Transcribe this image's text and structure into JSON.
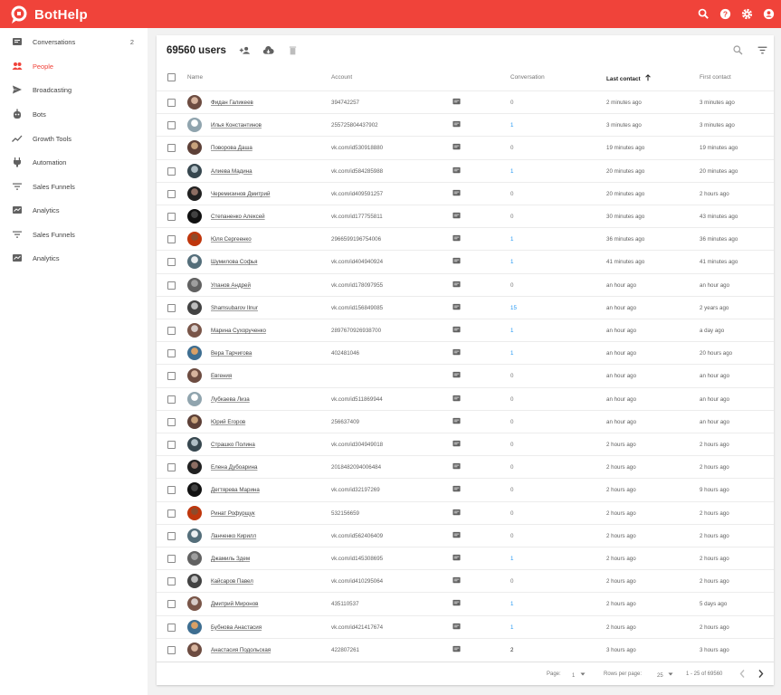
{
  "app": {
    "name": "BotHelp"
  },
  "topbar_icons": [
    "search-icon",
    "help-icon",
    "gear-icon",
    "account-icon"
  ],
  "sidebar": {
    "items": [
      {
        "label": "Conversations",
        "count": "2",
        "icon": "chat-icon",
        "active": false
      },
      {
        "label": "People",
        "count": "",
        "icon": "people-icon",
        "active": true
      },
      {
        "label": "Broadcasting",
        "count": "",
        "icon": "send-icon",
        "active": false
      },
      {
        "label": "Bots",
        "count": "",
        "icon": "bot-icon",
        "active": false
      },
      {
        "label": "Growth Tools",
        "count": "",
        "icon": "trending-icon",
        "active": false
      },
      {
        "label": "Automation",
        "count": "",
        "icon": "plug-icon",
        "active": false
      },
      {
        "label": "Sales Funnels",
        "count": "",
        "icon": "filter-icon",
        "active": false
      },
      {
        "label": "Analytics",
        "count": "",
        "icon": "analytics-icon",
        "active": false
      },
      {
        "label": "Sales Funnels",
        "count": "",
        "icon": "filter-icon",
        "active": false
      },
      {
        "label": "Analytics",
        "count": "",
        "icon": "analytics-icon",
        "active": false
      }
    ]
  },
  "main": {
    "title": "69560 users",
    "columns": {
      "name": "Name",
      "account": "Account",
      "conversation": "Conversation",
      "last_contact": "Last contact",
      "first_contact": "First contact"
    },
    "rows": [
      {
        "name": "Фидан Галикеев",
        "account": "394742257",
        "conversation": "0",
        "last": "2 minutes ago",
        "first": "3 minutes ago"
      },
      {
        "name": "Илья Константинов",
        "account": "255725804437902",
        "conversation": "1",
        "last": "3 minutes ago",
        "first": "3 minutes ago"
      },
      {
        "name": "Поворова Даша",
        "account": "vk.com/id530918880",
        "conversation": "0",
        "last": "19 minutes ago",
        "first": "19 minutes ago"
      },
      {
        "name": "Алиева Мадина",
        "account": "vk.com/id584285988",
        "conversation": "1",
        "last": "20 minutes ago",
        "first": "20 minutes ago"
      },
      {
        "name": "Черемизинов Дмитрий",
        "account": "vk.com/id409591257",
        "conversation": "0",
        "last": "20 minutes ago",
        "first": "2 hours ago"
      },
      {
        "name": "Степаненко Алексей",
        "account": "vk.com/id177755811",
        "conversation": "0",
        "last": "30 minutes ago",
        "first": "43 minutes ago"
      },
      {
        "name": "Юля Сергеенко",
        "account": "2966599196754006",
        "conversation": "1",
        "last": "36 minutes ago",
        "first": "36 minutes ago"
      },
      {
        "name": "Шумилова Софья",
        "account": "vk.com/id404940924",
        "conversation": "1",
        "last": "41 minutes ago",
        "first": "41 minutes ago"
      },
      {
        "name": "Уланов Андрей",
        "account": "vk.com/id178097955",
        "conversation": "0",
        "last": "an hour ago",
        "first": "an hour ago"
      },
      {
        "name": "Shamsubarov Ilnur",
        "account": "vk.com/id156849085",
        "conversation": "15",
        "last": "an hour ago",
        "first": "2 years ago"
      },
      {
        "name": "Марина Сухорученко",
        "account": "2897670926938700",
        "conversation": "1",
        "last": "an hour ago",
        "first": "a day ago"
      },
      {
        "name": "Вера Тарчигова",
        "account": "402481046",
        "conversation": "1",
        "last": "an hour ago",
        "first": "20 hours ago"
      },
      {
        "name": "Евгения",
        "account": "",
        "conversation": "0",
        "last": "an hour ago",
        "first": "an hour ago"
      },
      {
        "name": "Лубкаева Лиза",
        "account": "vk.com/id511869944",
        "conversation": "0",
        "last": "an hour ago",
        "first": "an hour ago"
      },
      {
        "name": "Юрий Егоров",
        "account": "256637409",
        "conversation": "0",
        "last": "an hour ago",
        "first": "an hour ago"
      },
      {
        "name": "Страшко Полина",
        "account": "vk.com/id304949018",
        "conversation": "0",
        "last": "2 hours ago",
        "first": "2 hours ago"
      },
      {
        "name": "Елена Дубоарина",
        "account": "2018482094006484",
        "conversation": "0",
        "last": "2 hours ago",
        "first": "2 hours ago"
      },
      {
        "name": "Дегтярева Марина",
        "account": "vk.com/id32197269",
        "conversation": "0",
        "last": "2 hours ago",
        "first": "9 hours ago"
      },
      {
        "name": "Ринат Рофурщук",
        "account": "532156659",
        "conversation": "0",
        "last": "2 hours ago",
        "first": "2 hours ago"
      },
      {
        "name": "Ланченко Кирилл",
        "account": "vk.com/id562406409",
        "conversation": "0",
        "last": "2 hours ago",
        "first": "2 hours ago"
      },
      {
        "name": "Джамиль Здем",
        "account": "vk.com/id145308695",
        "conversation": "1",
        "last": "2 hours ago",
        "first": "2 hours ago"
      },
      {
        "name": "Кайсаров Павел",
        "account": "vk.com/id410295064",
        "conversation": "0",
        "last": "2 hours ago",
        "first": "2 hours ago"
      },
      {
        "name": "Дмитрий Миронов",
        "account": "435110537",
        "conversation": "1",
        "last": "2 hours ago",
        "first": "5 days ago"
      },
      {
        "name": "Бубнова Анастасия",
        "account": "vk.com/id421417674",
        "conversation": "1",
        "last": "2 hours ago",
        "first": "2 hours ago"
      },
      {
        "name": "Анастасия Подольская",
        "account": "422807261",
        "conversation": "2",
        "last": "3 hours ago",
        "first": "3 hours ago"
      }
    ],
    "pagination": {
      "page_label": "Page:",
      "page": "1",
      "rows_label": "Rows per page:",
      "rows": "25",
      "range": "1 - 25 of 69560"
    }
  },
  "colors": {
    "brand": "#f0433a",
    "link_blue": "#2196f3"
  }
}
